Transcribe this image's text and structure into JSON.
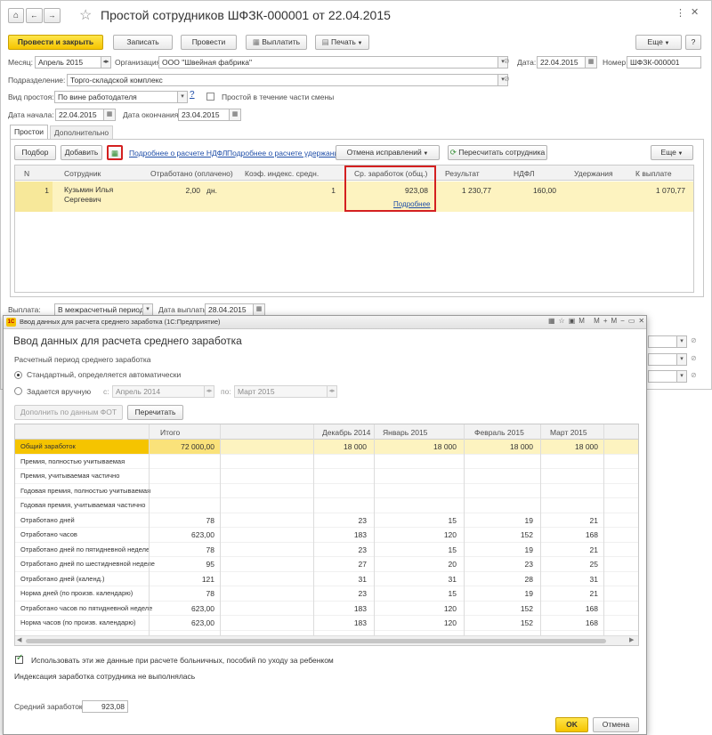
{
  "main": {
    "title": "Простой сотрудников ШФЗК-000001 от 22.04.2015",
    "toolbar": {
      "post_close": "Провести и закрыть",
      "save": "Записать",
      "post": "Провести",
      "pay": "Выплатить",
      "print": "Печать",
      "more": "Еще",
      "help": "?"
    },
    "fields": {
      "month_label": "Месяц:",
      "month": "Апрель 2015",
      "org_label": "Организация:",
      "org": "ООО \"Швейная фабрика\"",
      "date_label": "Дата:",
      "date": "22.04.2015",
      "num_label": "Номер:",
      "num": "ШФЗК-000001",
      "div_label": "Подразделение:",
      "div": "Торго-складской комплекс",
      "type_label": "Вид простоя:",
      "type": "По вине работодателя",
      "partial_label": "Простой в течение части смены",
      "start_label": "Дата начала:",
      "start": "22.04.2015",
      "end_label": "Дата окончания:",
      "end": "23.04.2015"
    },
    "tabs": [
      "Простои",
      "Дополнительно"
    ],
    "tab_toolbar": {
      "pick": "Подбор",
      "add": "Добавить",
      "ndfl_link": "Подробнее о расчете НДФЛ",
      "ded_link": "Подробнее о расчете удержаний",
      "cancel_fix": "Отмена исправлений",
      "recalc": "Пересчитать сотрудника",
      "more": "Еще"
    },
    "grid": {
      "headers": [
        "N",
        "Сотрудник",
        "Отработано (оплачено)",
        "Коэф. индекс. средн.",
        "Ср. заработок (общ.)",
        "Результат",
        "НДФЛ",
        "Удержания",
        "К выплате"
      ],
      "rows": [
        {
          "n": "1",
          "emp": "Кузьмин Илья Сергеевич",
          "worked": "2,00",
          "unit": "дн.",
          "coef": "1",
          "avg": "923,08",
          "more": "Подробнее",
          "result": "1 230,77",
          "ndfl": "160,00",
          "ded": "",
          "pay": "1 070,77"
        }
      ]
    },
    "payment": {
      "label": "Выплата:",
      "value": "В межрасчетный период",
      "date_label": "Дата выплаты:",
      "date": "28.04.2015"
    }
  },
  "dialog": {
    "titlebar": "Ввод данных для расчета среднего заработка (1С:Предприятие)",
    "title": "Ввод данных для расчета среднего заработка",
    "period_label": "Расчетный период среднего заработка",
    "radio_auto": "Стандартный, определяется автоматически",
    "radio_manual": "Задается вручную",
    "from_label": "с:",
    "from": "Апрель 2014",
    "to_label": "по:",
    "to": "Март 2015",
    "fill_btn": "Дополнить по данным ФОТ",
    "reread_btn": "Перечитать",
    "table": {
      "total_header": "Итого",
      "months": [
        "Декабрь 2014",
        "Январь 2015",
        "Февраль 2015",
        "Март 2015"
      ],
      "rows": [
        {
          "label": "Общий заработок",
          "total": "72 000,00",
          "vals": [
            "18 000",
            "18 000",
            "18 000",
            "18 000"
          ]
        },
        {
          "label": "Премия, полностью учитываемая",
          "total": "",
          "vals": [
            "",
            "",
            "",
            ""
          ]
        },
        {
          "label": "Премия, учитываемая частично",
          "total": "",
          "vals": [
            "",
            "",
            "",
            ""
          ]
        },
        {
          "label": "Годовая премия, полностью учитываемая",
          "total": "",
          "vals": [
            "",
            "",
            "",
            ""
          ]
        },
        {
          "label": "Годовая премия, учитываемая частично",
          "total": "",
          "vals": [
            "",
            "",
            "",
            ""
          ]
        },
        {
          "label": "Отработано дней",
          "total": "78",
          "vals": [
            "23",
            "15",
            "19",
            "21"
          ]
        },
        {
          "label": "Отработано часов",
          "total": "623,00",
          "vals": [
            "183",
            "120",
            "152",
            "168"
          ]
        },
        {
          "label": "Отработано дней по пятидневной неделе",
          "total": "78",
          "vals": [
            "23",
            "15",
            "19",
            "21"
          ]
        },
        {
          "label": "Отработано дней по шестидневной неделе",
          "total": "95",
          "vals": [
            "27",
            "20",
            "23",
            "25"
          ]
        },
        {
          "label": "Отработано дней (календ.)",
          "total": "121",
          "vals": [
            "31",
            "31",
            "28",
            "31"
          ]
        },
        {
          "label": "Норма дней (по произв. календарю)",
          "total": "78",
          "vals": [
            "23",
            "15",
            "19",
            "21"
          ]
        },
        {
          "label": "Отработано часов по пятидневной неделе",
          "total": "623,00",
          "vals": [
            "183",
            "120",
            "152",
            "168"
          ]
        },
        {
          "label": "Норма часов (по произв. календарю)",
          "total": "623,00",
          "vals": [
            "183",
            "120",
            "152",
            "168"
          ]
        }
      ]
    },
    "use_checkbox": "Использовать эти же данные при расчете больничных, пособий по уходу за ребенком",
    "index_note": "Индексация заработка сотрудника не выполнялась",
    "avg_label": "Средний заработок:",
    "avg": "923,08",
    "ok": "OK",
    "cancel": "Отмена"
  }
}
